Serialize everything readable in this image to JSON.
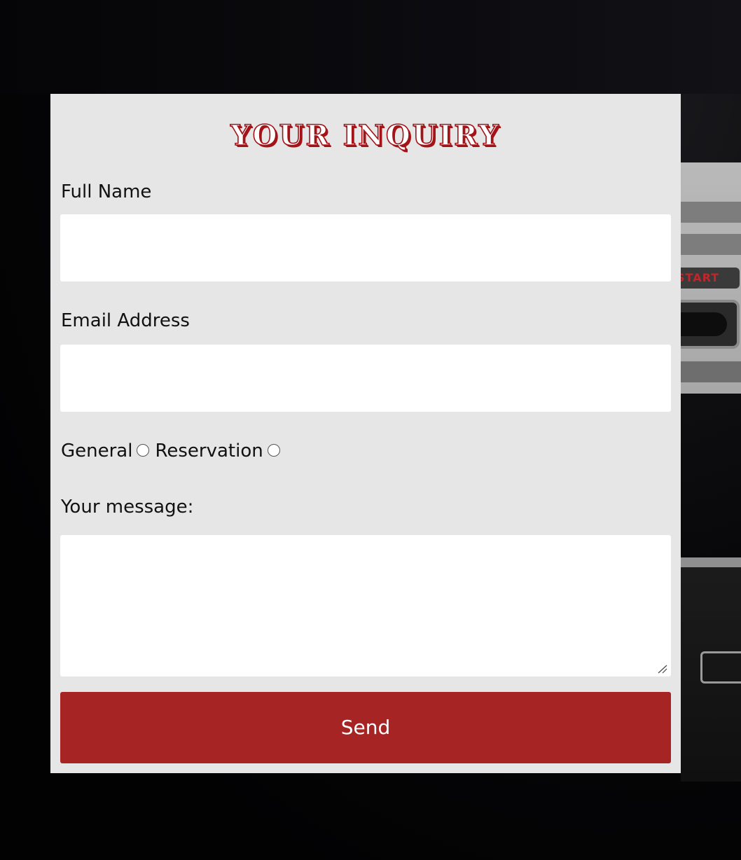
{
  "form": {
    "title": "YOUR INQUIRY",
    "full_name_label": "Full Name",
    "full_name_value": "",
    "email_label": "Email Address",
    "email_value": "",
    "inquiry_types": [
      {
        "label": "General",
        "checked": false
      },
      {
        "label": "Reservation",
        "checked": false
      }
    ],
    "message_label": "Your message:",
    "message_value": "",
    "send_label": "Send"
  },
  "background": {
    "controller_button_label": "START"
  },
  "colors": {
    "accent": "#a72424",
    "title_outline": "#a31419",
    "card_background": "#e6e6e6",
    "page_background": "#000000"
  }
}
